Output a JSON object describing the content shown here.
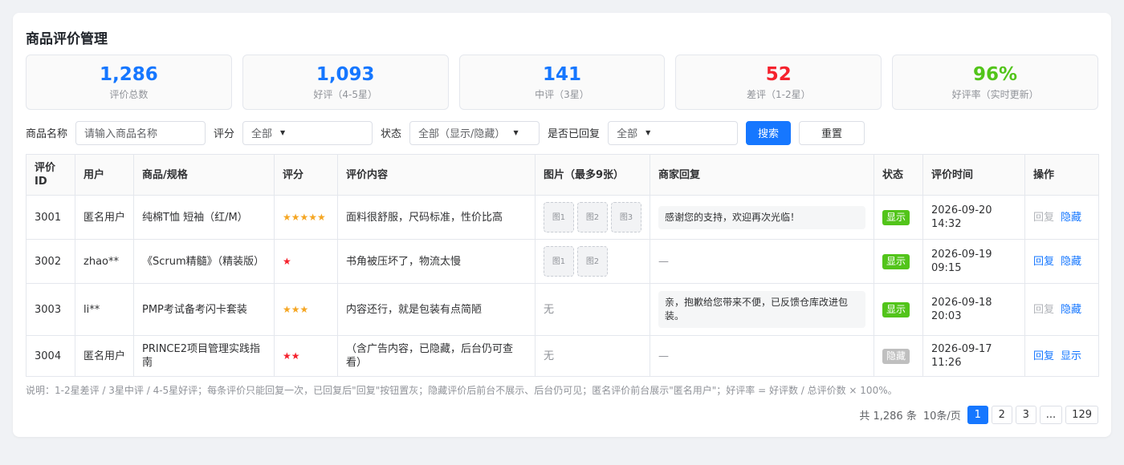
{
  "page": {
    "title": "商品评价管理"
  },
  "stats": [
    {
      "value": "1,286",
      "label": "评价总数",
      "color": "#1677ff"
    },
    {
      "value": "1,093",
      "label": "好评（4-5星）",
      "color": "#1677ff"
    },
    {
      "value": "141",
      "label": "中评（3星）",
      "color": "#1677ff"
    },
    {
      "value": "52",
      "label": "差评（1-2星）",
      "color": "#f5222d"
    },
    {
      "value": "96%",
      "label": "好评率（实时更新）",
      "color": "#52c41a"
    }
  ],
  "filters": {
    "product_label": "商品名称",
    "product_placeholder": "请输入商品名称",
    "rating_label": "评分",
    "rating_value": "全部",
    "status_label": "状态",
    "status_value": "全部（显示/隐藏）",
    "replied_label": "是否已回复",
    "replied_value": "全部",
    "search_label": "搜索",
    "reset_label": "重置"
  },
  "table": {
    "headers": [
      "评价ID",
      "用户",
      "商品/规格",
      "评分",
      "评价内容",
      "图片（最多9张）",
      "商家回复",
      "状态",
      "评价时间",
      "操作"
    ],
    "rows": [
      {
        "id": "3001",
        "user": "匿名用户",
        "product": "纯棉T恤 短袖（红/M）",
        "stars": "★★★★★",
        "star_type": "good",
        "content": "面料很舒服，尺码标准，性价比高",
        "images": [
          "图1",
          "图2",
          "图3"
        ],
        "no_image": "",
        "reply": "感谢您的支持，欢迎再次光临！",
        "status": "显示",
        "status_type": "show",
        "date": "2026-09-20",
        "time": "14:32",
        "op1": "回复",
        "op1_disabled": true,
        "op2": "隐藏"
      },
      {
        "id": "3002",
        "user": "zhao**",
        "product": "《Scrum精髓》（精装版）",
        "stars": "★",
        "star_type": "bad",
        "content": "书角被压坏了，物流太慢",
        "images": [
          "图1",
          "图2"
        ],
        "no_image": "",
        "reply": "—",
        "status": "显示",
        "status_type": "show",
        "date": "2026-09-19",
        "time": "09:15",
        "op1": "回复",
        "op1_disabled": false,
        "op2": "隐藏"
      },
      {
        "id": "3003",
        "user": "li**",
        "product": "PMP考试备考闪卡套装",
        "stars": "★★★",
        "star_type": "good",
        "content": "内容还行，就是包装有点简陋",
        "images": [],
        "no_image": "无",
        "reply": "亲，抱歉给您带来不便，已反馈仓库改进包装。",
        "status": "显示",
        "status_type": "show",
        "date": "2026-09-18",
        "time": "20:03",
        "op1": "回复",
        "op1_disabled": true,
        "op2": "隐藏"
      },
      {
        "id": "3004",
        "user": "匿名用户",
        "product": "PRINCE2项目管理实践指南",
        "stars": "★★",
        "star_type": "bad",
        "content": "（含广告内容，已隐藏，后台仍可查看）",
        "images": [],
        "no_image": "无",
        "reply": "—",
        "status": "隐藏",
        "status_type": "hide",
        "date": "2026-09-17",
        "time": "11:26",
        "op1": "回复",
        "op1_disabled": false,
        "op2": "显示"
      }
    ]
  },
  "note": "说明：1-2星差评 / 3星中评 / 4-5星好评；每条评价只能回复一次，已回复后\"回复\"按钮置灰；隐藏评价后前台不展示、后台仍可见；匿名评价前台展示\"匿名用户\"；好评率 = 好评数 / 总评价数 × 100%。",
  "pagination": {
    "total": "共 1,286 条",
    "page_size": "10条/页",
    "pages": [
      "1",
      "2",
      "3",
      "...",
      "129"
    ],
    "current": "1"
  }
}
